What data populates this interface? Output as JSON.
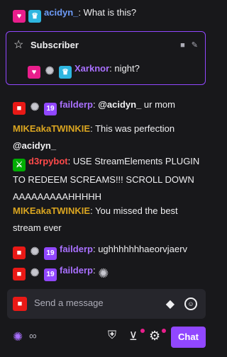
{
  "messages": [
    {
      "user": "acidyn_",
      "text": "What is this?"
    },
    {
      "user": "failderp",
      "sub_months": "19",
      "mention": "@acidyn_",
      "text": " ur mom"
    },
    {
      "user": "MIKEakaTWINKIE",
      "text": "This was perfection",
      "mention": "@acidyn_"
    },
    {
      "user": "d3rpybot",
      "text": "USE StreamElements PLUGIN TO REDEEM SCREAMS!!! SCROLL DOWN AAAAAAAAAHHHHH"
    },
    {
      "user": "MIKEakaTWINKIE",
      "text": "You missed the best stream ever"
    },
    {
      "user": "failderp",
      "sub_months": "19",
      "text": "ughhhhhhhaeorvjaerv"
    },
    {
      "user": "failderp",
      "sub_months": "19",
      "text": ""
    }
  ],
  "highlight": {
    "title": "Subscriber",
    "user": "Xarknor",
    "text": "night?"
  },
  "input": {
    "placeholder": "Send a message"
  },
  "bottom": {
    "points": "∞",
    "chat_button": "Chat"
  },
  "colors": {
    "background": "#18181b",
    "accent": "#9147ff",
    "username_blue": "#6d9bf7",
    "username_purple": "#a970ff",
    "username_gold": "#daa520",
    "username_red": "#ff4a4a"
  }
}
